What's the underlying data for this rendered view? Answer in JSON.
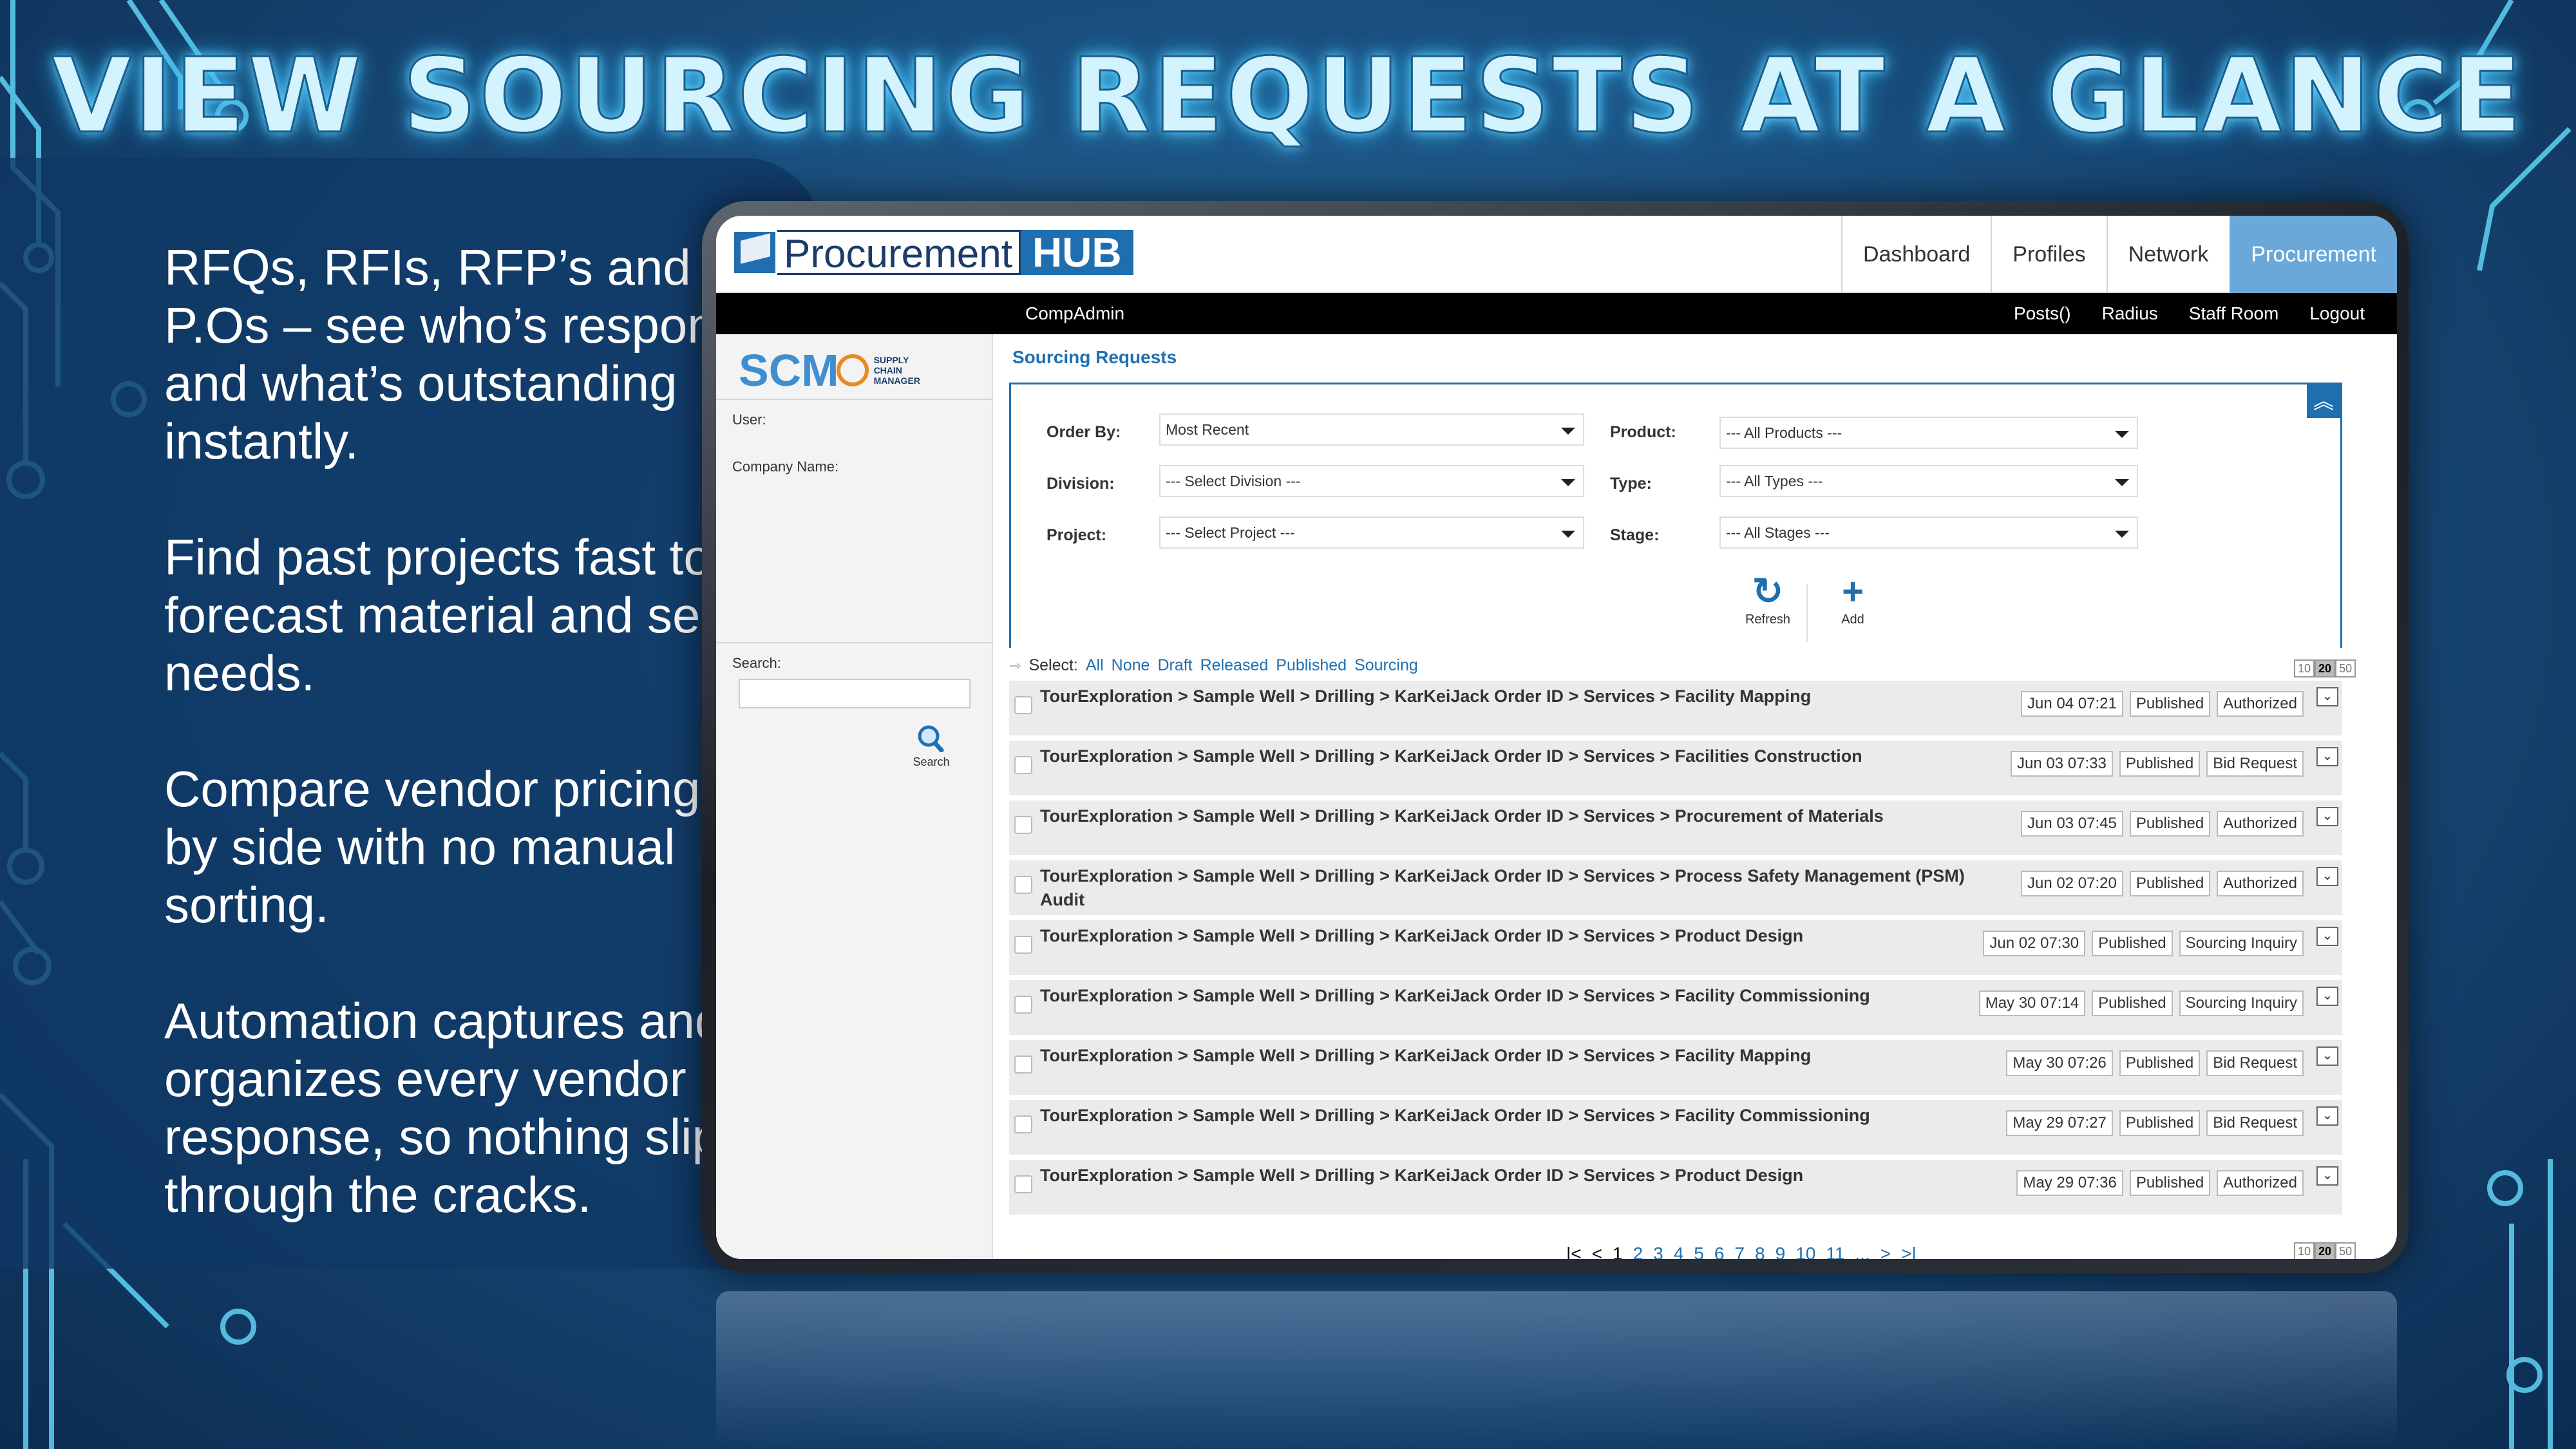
{
  "headline": "VIEW SOURCING REQUESTS AT A GLANCE",
  "blurbs": [
    "RFQs, RFIs, RFP’s and P.Os – see who’s responded and what’s outstanding instantly.",
    "Find past projects fast to forecast material and service needs.",
    "Compare vendor pricing side by side with no manual sorting.",
    "Automation captures and organizes every vendor response, so nothing slips through the cracks."
  ],
  "app": {
    "logo_word": "Procurement",
    "logo_hub": "HUB",
    "nav": [
      "Dashboard",
      "Profiles",
      "Network",
      "Procurement"
    ],
    "active_nav": "Procurement",
    "user_label": "CompAdmin",
    "top_links": [
      "Posts()",
      "Radius",
      "Staff Room",
      "Logout"
    ]
  },
  "sidebar": {
    "brand": "SCM",
    "brand_sub": [
      "SUPPLY",
      "CHAIN",
      "MANAGER"
    ],
    "user_label": "User:",
    "company_label": "Company Name:",
    "search_label": "Search:",
    "search_button": "Search"
  },
  "page": {
    "title": "Sourcing Requests",
    "filters": {
      "order_by": {
        "label": "Order By:",
        "value": "Most Recent"
      },
      "division": {
        "label": "Division:",
        "value": "--- Select Division ---"
      },
      "project": {
        "label": "Project:",
        "value": "--- Select Project ---"
      },
      "product": {
        "label": "Product:",
        "value": "--- All Products ---"
      },
      "type": {
        "label": "Type:",
        "value": "--- All Types ---"
      },
      "stage": {
        "label": "Stage:",
        "value": "--- All Stages ---"
      }
    },
    "actions": {
      "refresh": "Refresh",
      "add": "Add"
    },
    "select_label": "Select:",
    "select_links": [
      "All",
      "None",
      "Draft",
      "Released",
      "Published",
      "Sourcing"
    ],
    "page_sizes": [
      "10",
      "20",
      "50"
    ],
    "active_page_size": "20",
    "rows": [
      {
        "path": "TourExploration > Sample Well > Drilling > KarKeiJack Order ID > Services > Facility Mapping",
        "date": "Jun 04 07:21",
        "status": "Published",
        "stage": "Authorized"
      },
      {
        "path": "TourExploration > Sample Well > Drilling > KarKeiJack Order ID > Services > Facilities Construction",
        "date": "Jun 03 07:33",
        "status": "Published",
        "stage": "Bid Request"
      },
      {
        "path": "TourExploration > Sample Well > Drilling > KarKeiJack Order ID > Services > Procurement of Materials",
        "date": "Jun 03 07:45",
        "status": "Published",
        "stage": "Authorized"
      },
      {
        "path": "TourExploration > Sample Well > Drilling > KarKeiJack Order ID > Services > Process Safety Management (PSM) Audit",
        "date": "Jun 02 07:20",
        "status": "Published",
        "stage": "Authorized"
      },
      {
        "path": "TourExploration > Sample Well > Drilling > KarKeiJack Order ID > Services > Product Design",
        "date": "Jun 02 07:30",
        "status": "Published",
        "stage": "Sourcing Inquiry"
      },
      {
        "path": "TourExploration > Sample Well > Drilling > KarKeiJack Order ID > Services > Facility Commissioning",
        "date": "May 30 07:14",
        "status": "Published",
        "stage": "Sourcing Inquiry"
      },
      {
        "path": "TourExploration > Sample Well > Drilling > KarKeiJack Order ID > Services > Facility Mapping",
        "date": "May 30 07:26",
        "status": "Published",
        "stage": "Bid Request"
      },
      {
        "path": "TourExploration > Sample Well > Drilling > KarKeiJack Order ID > Services > Facility Commissioning",
        "date": "May 29 07:27",
        "status": "Published",
        "stage": "Bid Request"
      },
      {
        "path": "TourExploration > Sample Well > Drilling > KarKeiJack Order ID > Services > Product Design",
        "date": "May 29 07:36",
        "status": "Published",
        "stage": "Authorized"
      }
    ],
    "pager": {
      "first": "|<",
      "prev": "<",
      "pages": [
        "1",
        "2",
        "3",
        "4",
        "5",
        "6",
        "7",
        "8",
        "9",
        "10",
        "11"
      ],
      "current": "1",
      "ellipsis": "...",
      "next": ">",
      "last": ">|"
    }
  }
}
